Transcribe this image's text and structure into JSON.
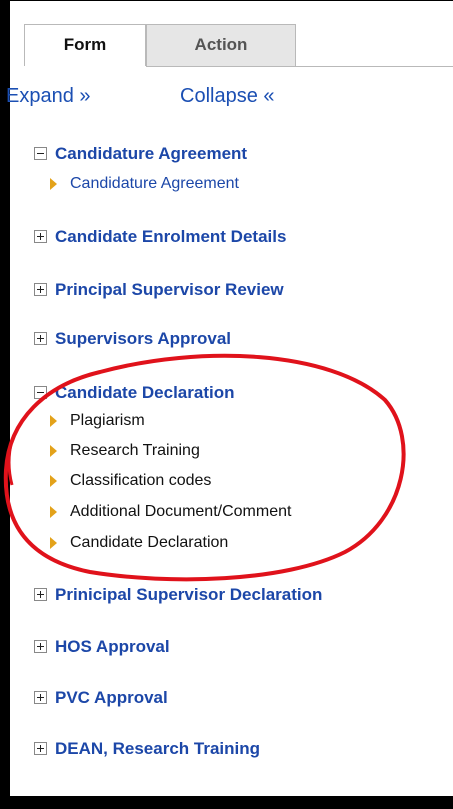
{
  "tabs": [
    {
      "label": "Form",
      "active": true
    },
    {
      "label": "Action",
      "active": false
    }
  ],
  "controls": {
    "expand": "Expand »",
    "collapse": "Collapse «"
  },
  "sections": [
    {
      "title": "Candidature Agreement",
      "expanded": true,
      "items": [
        "Candidature Agreement"
      ]
    },
    {
      "title": "Candidate Enrolment Details",
      "expanded": false
    },
    {
      "title": "Principal Supervisor Review",
      "expanded": false
    },
    {
      "title": "Supervisors Approval",
      "expanded": false
    },
    {
      "title": "Candidate Declaration",
      "expanded": true,
      "items": [
        "Plagiarism",
        "Research Training",
        "Classification codes",
        "Additional Document/Comment",
        "Candidate Declaration"
      ]
    },
    {
      "title": "Prinicipal Supervisor Declaration",
      "expanded": false
    },
    {
      "title": "HOS Approval",
      "expanded": false
    },
    {
      "title": "PVC Approval",
      "expanded": false
    },
    {
      "title": "DEAN, Research Training",
      "expanded": false
    }
  ],
  "colors": {
    "link": "#1c47a8",
    "arrow": "#e3a21a",
    "annotation": "#e0121b"
  }
}
